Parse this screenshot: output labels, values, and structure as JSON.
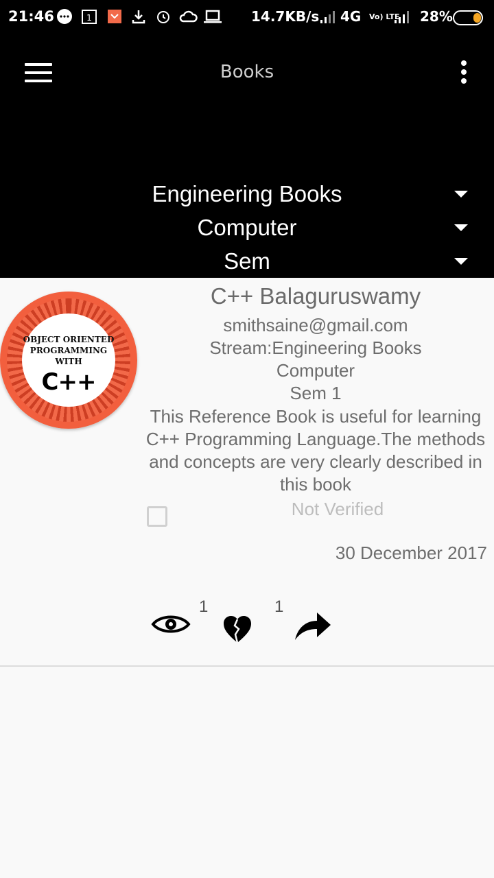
{
  "status_bar": {
    "time": "21:46",
    "net_speed": "14.7KB/s",
    "network": "4G",
    "volte": "Vo) LTE",
    "battery": "28%",
    "icons": [
      "chat-bubble-icon",
      "calendar-icon",
      "app-icon",
      "download-icon",
      "alarm-icon",
      "cloud-icon",
      "laptop-icon",
      "signal-icon",
      "battery-icon"
    ]
  },
  "app_bar": {
    "title": "Books",
    "menu_icon": "hamburger-menu-icon",
    "overflow_icon": "more-vert-icon"
  },
  "filters": [
    {
      "label": "Engineering Books"
    },
    {
      "label": "Computer"
    },
    {
      "label": "Sem"
    }
  ],
  "book": {
    "cover_text": "OBJECT ORIENTED PROGRAMMING WITH",
    "cover_title": "C++",
    "title": "C++ Balaguruswamy",
    "email": "smithsaine@gmail.com",
    "stream": "Stream:Engineering Books",
    "branch": "Computer",
    "sem": "Sem 1",
    "description": "This Reference Book is useful for learning C++ Programming Language.The methods and concepts are very clearly described in this book",
    "verified_label": "Not Verified",
    "verified": false,
    "date": "30 December 2017",
    "views": "1",
    "likes": "1"
  },
  "colors": {
    "app_bar": "#000000",
    "background": "#f9f9f9",
    "text_secondary": "#6d6d6d",
    "battery_accent": "#f5a623"
  }
}
